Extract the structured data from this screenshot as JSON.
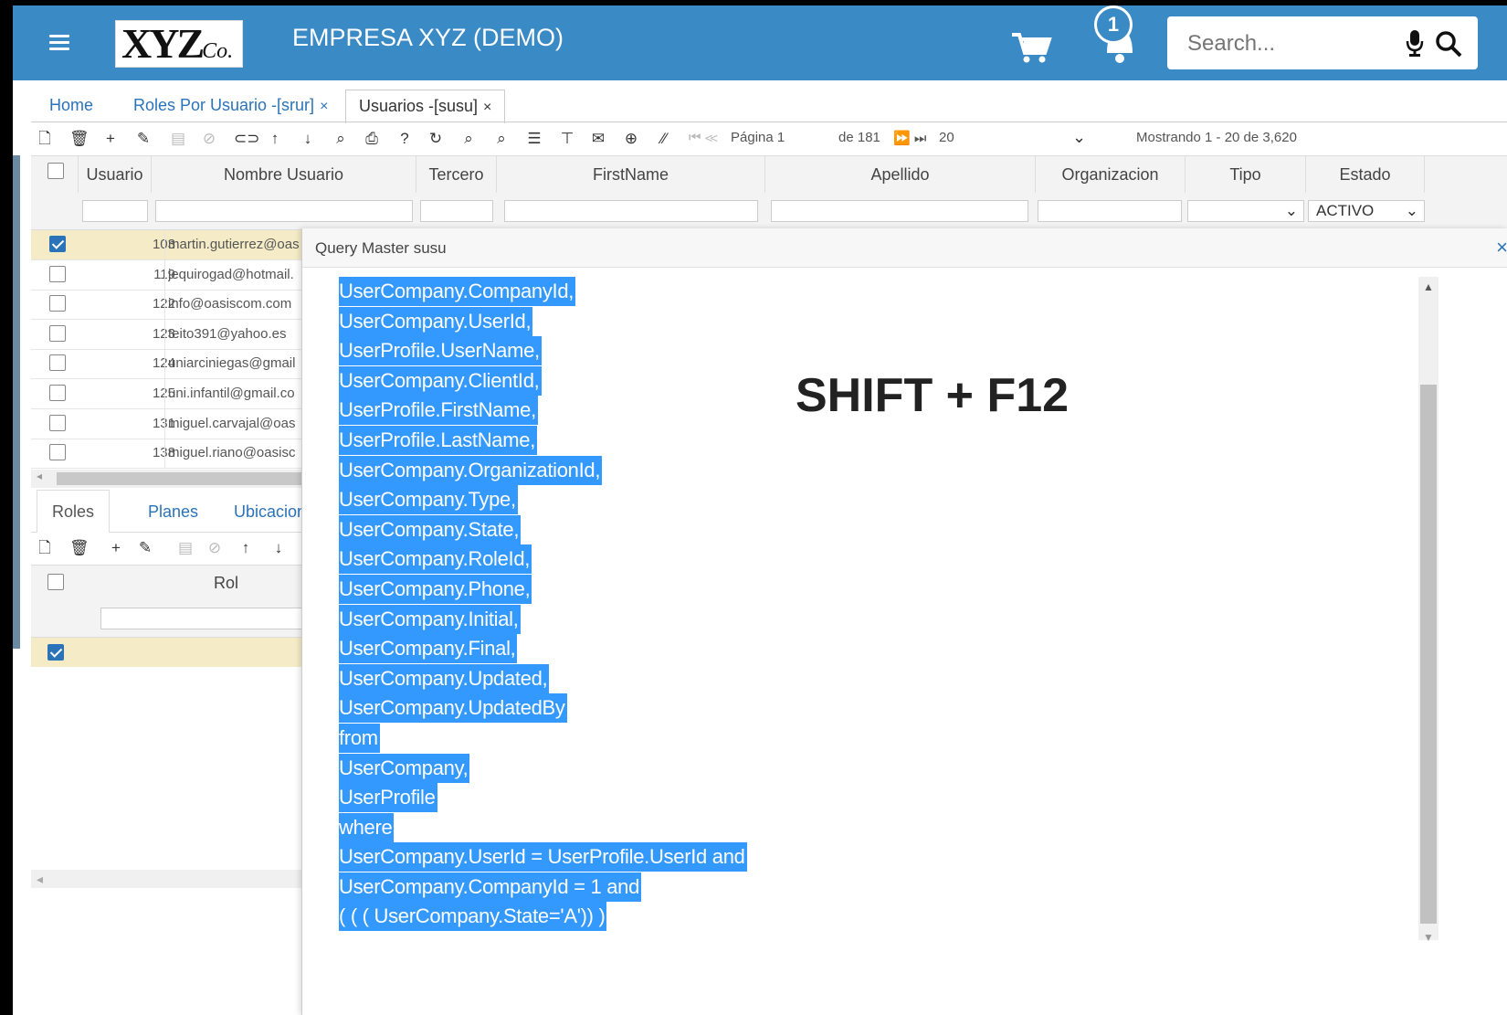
{
  "header": {
    "logo_text": "XYZ",
    "logo_suffix": "Co.",
    "company": "EMPRESA XYZ (DEMO)",
    "notifications": "1",
    "search_placeholder": "Search..."
  },
  "tabs": [
    {
      "label": "Home"
    },
    {
      "label": "Roles Por Usuario -[srur]",
      "close": "×"
    },
    {
      "label": "Usuarios -[susu]",
      "close": "×"
    }
  ],
  "toolbar": {
    "page_label": "Página 1",
    "of_pages": "de 181",
    "page_size": "20",
    "showing": "Mostrando 1 - 20 de 3,620"
  },
  "grid": {
    "columns": [
      "Usuario",
      "Nombre Usuario",
      "Tercero",
      "FirstName",
      "Apellido",
      "Organizacion",
      "Tipo",
      "Estado"
    ],
    "estado_filter": "ACTIVO",
    "rows": [
      {
        "id": "103",
        "email": "martin.gutierrez@oas",
        "checked": true
      },
      {
        "id": "119",
        "email": "jequirogad@hotmail.",
        "checked": false
      },
      {
        "id": "122",
        "email": "info@oasiscom.com",
        "checked": false
      },
      {
        "id": "123",
        "email": "teito391@yahoo.es",
        "checked": false
      },
      {
        "id": "124",
        "email": "uniarciniegas@gmail",
        "checked": false
      },
      {
        "id": "125",
        "email": "uni.infantil@gmail.co",
        "checked": false
      },
      {
        "id": "131",
        "email": "miguel.carvajal@oas",
        "checked": false
      },
      {
        "id": "138",
        "email": "miguel.riano@oasisc",
        "checked": false
      }
    ]
  },
  "subtabs": [
    "Roles",
    "Planes",
    "Ubicacion"
  ],
  "subgrid": {
    "column": "Rol"
  },
  "modal": {
    "title": "Query Master susu",
    "close": "×",
    "shortcut": "SHIFT + F12",
    "sql_lines": [
      "UserCompany.CompanyId,",
      "UserCompany.UserId,",
      "UserProfile.UserName,",
      "UserCompany.ClientId,",
      "UserProfile.FirstName,",
      "UserProfile.LastName,",
      "UserCompany.OrganizationId,",
      "UserCompany.Type,",
      "UserCompany.State,",
      "UserCompany.RoleId,",
      "UserCompany.Phone,",
      "UserCompany.Initial,",
      "UserCompany.Final,",
      "UserCompany.Updated,",
      "UserCompany.UpdatedBy",
      "from",
      "UserCompany,",
      "UserProfile",
      "where",
      "UserCompany.UserId = UserProfile.UserId and",
      "UserCompany.CompanyId = 1 and",
      "( ( ( UserCompany.State='A')) )"
    ]
  }
}
